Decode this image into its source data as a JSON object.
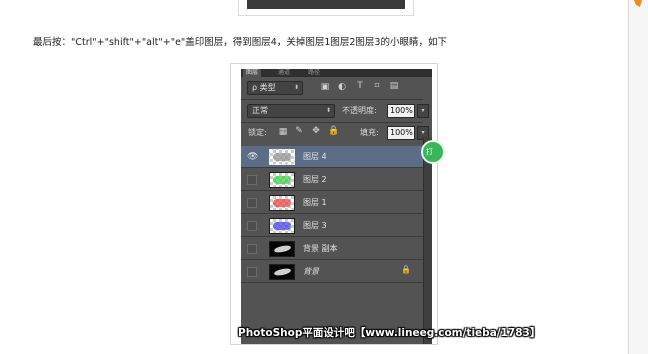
{
  "instruction_text": "最后按：\"Ctrl\"+\"shift\"+\"alt\"+\"e\"盖印图层，得到图层4，关掉图层1图层2图层3的小眼睛，如下",
  "panel": {
    "tabs": [
      "图层",
      "通道",
      "路径"
    ],
    "filter": {
      "prefix": "ρ",
      "value": "类型"
    },
    "blend_mode": "正常",
    "opacity_label": "不透明度:",
    "opacity_value": "100%",
    "lock_label": "锁定:",
    "fill_label": "填充:",
    "fill_value": "100%",
    "green_badge": "打",
    "layers": [
      {
        "name": "图层 4",
        "visible": true,
        "selected": true,
        "thumb": "transparent",
        "tint": "#8f8f8f"
      },
      {
        "name": "图层 2",
        "visible": false,
        "selected": false,
        "thumb": "transparent",
        "tint": "#35d13f"
      },
      {
        "name": "图层 1",
        "visible": false,
        "selected": false,
        "thumb": "transparent",
        "tint": "#ef3b3b"
      },
      {
        "name": "图层 3",
        "visible": false,
        "selected": false,
        "thumb": "transparent",
        "tint": "#3b3bef"
      },
      {
        "name": "背景 副本",
        "visible": false,
        "selected": false,
        "thumb": "dark",
        "tint": ""
      },
      {
        "name": "背景",
        "visible": false,
        "selected": false,
        "thumb": "dark",
        "tint": "",
        "locked": true
      }
    ]
  },
  "watermark": "PhotoShop平面设计吧【www.lineeg.com/tieba/1783】"
}
